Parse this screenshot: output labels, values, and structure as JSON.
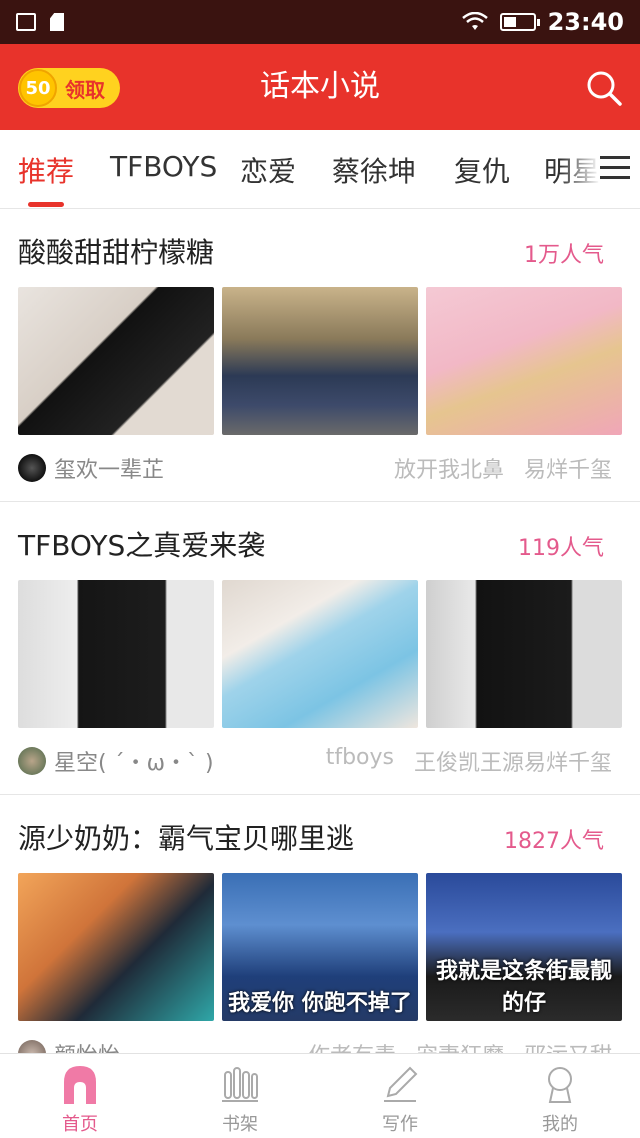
{
  "status_bar": {
    "time": "23:40"
  },
  "header": {
    "coin_count": "50",
    "claim_label": "领取",
    "title": "话本小说"
  },
  "tabs": [
    "推荐",
    "TFBOYS",
    "恋爱",
    "蔡徐坤",
    "复仇",
    "明星"
  ],
  "cards": [
    {
      "title": "酸酸甜甜柠檬糖",
      "popularity": "1万人气",
      "author": "玺欢一辈芷",
      "tags": [
        "放开我北鼻",
        "易烊千玺"
      ],
      "thumb_captions": [
        "",
        "",
        ""
      ]
    },
    {
      "title": "TFBOYS之真爱来袭",
      "popularity": "119人气",
      "author": "星空( ´・ω・` )",
      "tags": [
        "tfboys",
        "王俊凯王源易烊千玺"
      ],
      "thumb_captions": [
        "",
        "",
        ""
      ]
    },
    {
      "title": "源少奶奶：霸气宝贝哪里逃",
      "popularity": "1827人气",
      "author": "颜怡怡",
      "tags": [
        "作者有毒",
        "宠妻狂魔",
        "邪运又甜"
      ],
      "thumb_captions": [
        "",
        "我爱你 你跑不掉了",
        "我就是这条街最靓的仔"
      ]
    }
  ],
  "bottom_nav": [
    "首页",
    "书架",
    "写作",
    "我的"
  ],
  "colors": {
    "brand": "#e8332b",
    "accent_pink": "#e45a8c",
    "status_bg": "#3a1310"
  }
}
